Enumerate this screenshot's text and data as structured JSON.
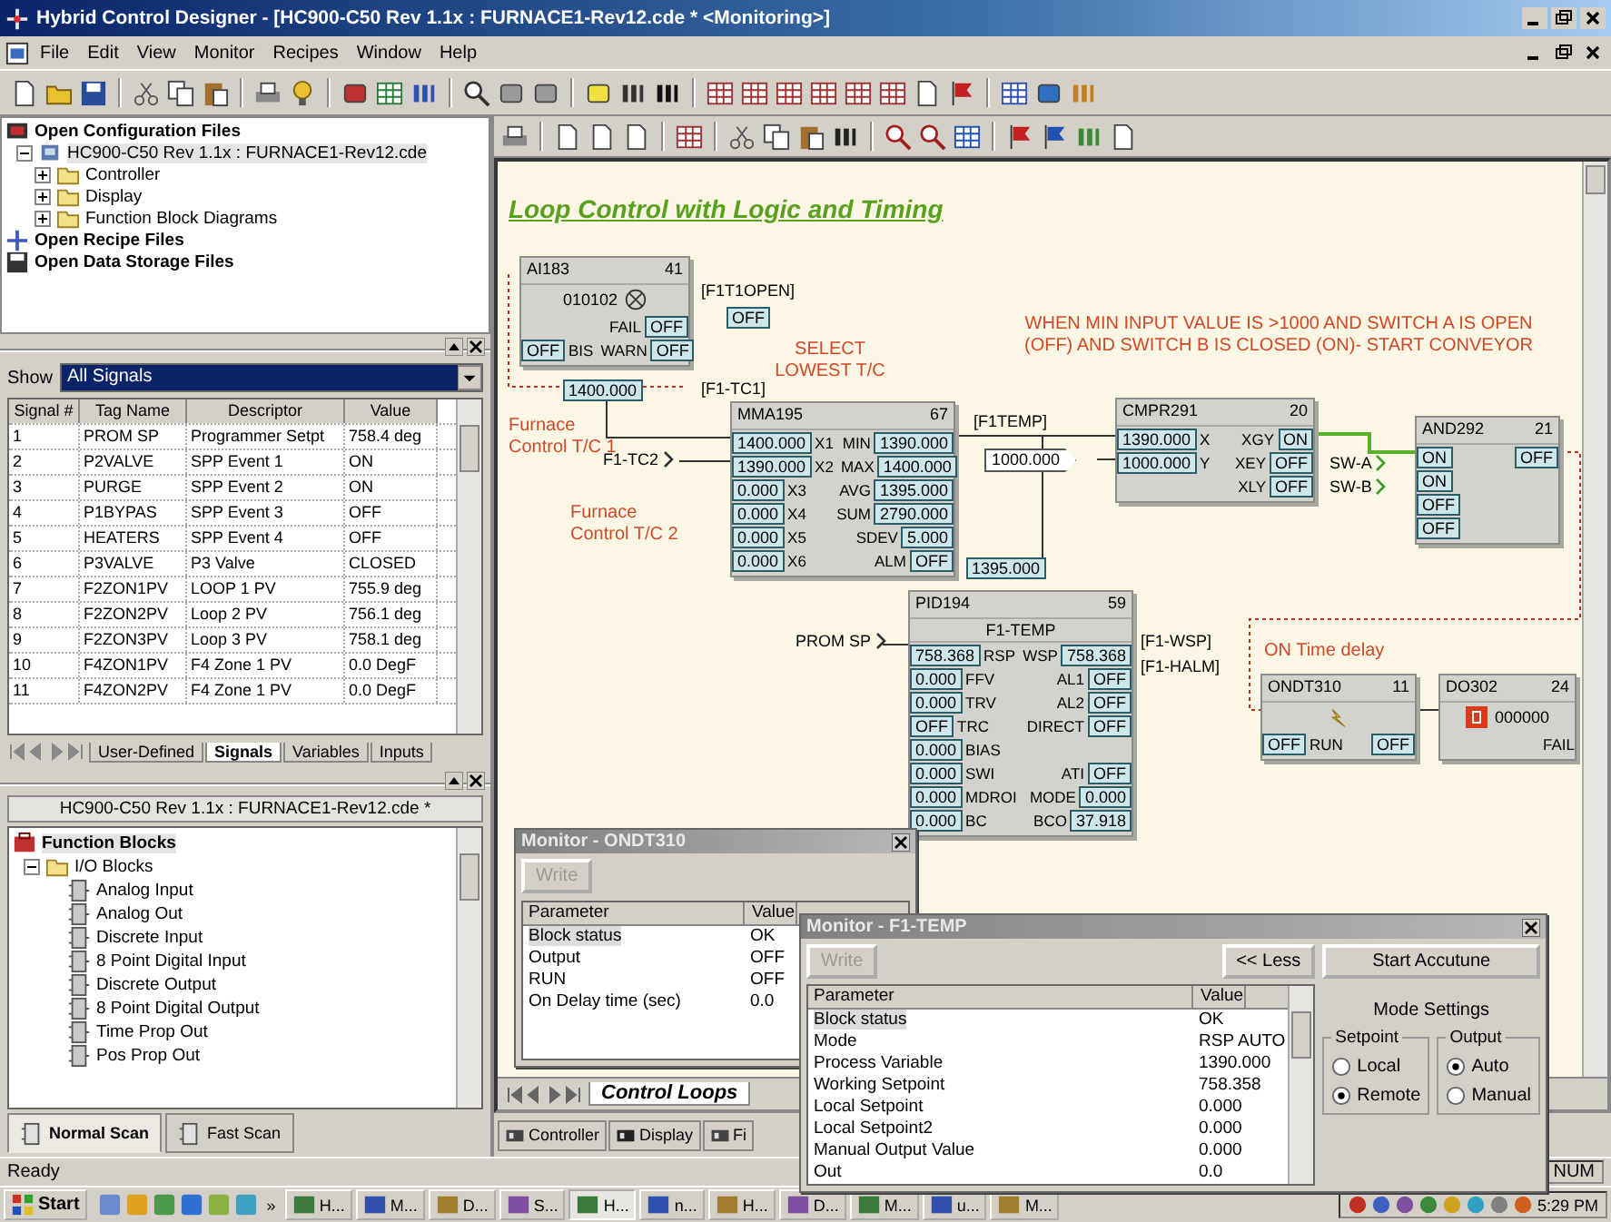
{
  "window": {
    "title": "Hybrid Control Designer  - [HC900-C50 Rev 1.1x : FURNACE1-Rev12.cde * <Monitoring>]"
  },
  "menu": [
    "File",
    "Edit",
    "View",
    "Monitor",
    "Recipes",
    "Window",
    "Help"
  ],
  "config_tree": [
    {
      "label": "Open Configuration Files",
      "selected": false,
      "children": [
        {
          "label": "HC900-C50 Rev 1.1x : FURNACE1-Rev12.cde",
          "selected": true,
          "expanded": true,
          "children": [
            {
              "label": "Controller",
              "selected": false,
              "expanded": false
            },
            {
              "label": "Display",
              "selected": false,
              "expanded": false
            },
            {
              "label": "Function Block Diagrams",
              "selected": false,
              "expanded": false
            }
          ]
        }
      ]
    },
    {
      "label": "Open Recipe Files",
      "selected": false
    },
    {
      "label": "Open Data Storage Files",
      "selected": false
    }
  ],
  "signals": {
    "show_label": "Show",
    "show_value": "All Signals",
    "columns": [
      "Signal #",
      "Tag Name",
      "Descriptor",
      "Value"
    ],
    "rows": [
      [
        "1",
        "PROM SP",
        "Programmer Setpt",
        "758.4 deg"
      ],
      [
        "2",
        "P2VALVE",
        "SPP Event 1",
        "ON"
      ],
      [
        "3",
        "PURGE",
        "SPP Event 2",
        "ON"
      ],
      [
        "4",
        "P1BYPAS",
        "SPP Event 3",
        "OFF"
      ],
      [
        "5",
        "HEATERS",
        "SPP Event 4",
        "OFF"
      ],
      [
        "6",
        "P3VALVE",
        "P3 Valve",
        "CLOSED"
      ],
      [
        "7",
        "F2ZON1PV",
        "LOOP 1 PV",
        "755.9 deg"
      ],
      [
        "8",
        "F2ZON2PV",
        "Loop 2 PV",
        "756.1 deg"
      ],
      [
        "9",
        "F2ZON3PV",
        "Loop 3 PV",
        "758.1 deg"
      ],
      [
        "10",
        "F4ZON1PV",
        "F4 Zone 1 PV",
        "0.0 DegF"
      ],
      [
        "11",
        "F4ZON2PV",
        "F4 Zone 1 PV",
        "0.0 DegF"
      ]
    ],
    "tabs": [
      {
        "label": "User-Defined",
        "selected": false
      },
      {
        "label": "Signals",
        "selected": true
      },
      {
        "label": "Variables",
        "selected": false
      },
      {
        "label": "Inputs",
        "selected": false
      }
    ]
  },
  "function_blocks": {
    "document": "HC900-C50 Rev 1.1x : FURNACE1-Rev12.cde *",
    "tree": {
      "label": "Function Blocks",
      "selected": true,
      "children": [
        {
          "label": "I/O Blocks",
          "selected": false,
          "expanded": true,
          "children": [
            {
              "label": "Analog Input",
              "selected": false
            },
            {
              "label": "Analog Out",
              "selected": false
            },
            {
              "label": "Discrete Input",
              "selected": false
            },
            {
              "label": "8 Point Digital Input",
              "selected": false
            },
            {
              "label": "Discrete Output",
              "selected": false
            },
            {
              "label": "8 Point Digital Output",
              "selected": false
            },
            {
              "label": "Time Prop Out",
              "selected": false
            },
            {
              "label": "Pos Prop Out",
              "selected": false
            }
          ]
        }
      ]
    },
    "tabs": [
      {
        "label": "Normal Scan",
        "selected": true
      },
      {
        "label": "Fast Scan",
        "selected": false
      }
    ]
  },
  "diagram": {
    "title": "Loop Control with Logic and Timing",
    "notes": [
      "SELECT\nLOWEST T/C",
      "Furnace\nControl T/C 1",
      "Furnace\nControl T/C 2",
      "WHEN MIN INPUT VALUE IS >1000 AND SWITCH A IS OPEN\n(OFF) AND SWITCH B IS CLOSED (ON)- START CONVEYOR",
      "ON Time delay"
    ],
    "tags": [
      "[F1T1OPEN]",
      "[F1-TC1]",
      "[F1TEMP]",
      "[F1-WSP]",
      "[F1-HALM]"
    ],
    "inputs": [
      "F1-TC2",
      "PROM SP",
      "SW-A",
      "SW-B"
    ],
    "constants": [
      "1000.000"
    ],
    "values": [
      "OFF",
      "1400.000",
      "1395.000"
    ],
    "blocks": [
      {
        "name": "AI183",
        "number": "41",
        "kind": "ai",
        "display": "010102",
        "rows": [
          {
            "out": "FAIL",
            "out_value": "OFF"
          },
          {
            "in": "BIS",
            "in_value": "OFF",
            "out": "WARN",
            "out_value": "OFF"
          }
        ]
      },
      {
        "name": "MMA195",
        "number": "67",
        "kind": "mma",
        "rows": [
          {
            "in": "X1",
            "in_value": "1400.000",
            "out": "MIN",
            "out_value": "1390.000"
          },
          {
            "in": "X2",
            "in_value": "1390.000",
            "out": "MAX",
            "out_value": "1400.000"
          },
          {
            "in": "X3",
            "in_value": "0.000",
            "out": "AVG",
            "out_value": "1395.000"
          },
          {
            "in": "X4",
            "in_value": "0.000",
            "out": "SUM",
            "out_value": "2790.000"
          },
          {
            "in": "X5",
            "in_value": "0.000",
            "out": "SDEV",
            "out_value": "5.000"
          },
          {
            "in": "X6",
            "in_value": "0.000",
            "out": "ALM",
            "out_value": "OFF"
          }
        ]
      },
      {
        "name": "PID194",
        "number": "59",
        "kind": "pid",
        "subtitle": "F1-TEMP",
        "rows": [
          {
            "in": "RSP",
            "in_value": "758.368",
            "out": "WSP",
            "out_value": "758.368"
          },
          {
            "in": "FFV",
            "in_value": "0.000",
            "out": "AL1",
            "out_value": "OFF"
          },
          {
            "in": "TRV",
            "in_value": "0.000",
            "out": "AL2",
            "out_value": "OFF"
          },
          {
            "in": "TRC",
            "in_value": "OFF",
            "out": "DIRECT",
            "out_value": "OFF"
          },
          {
            "in": "BIAS",
            "in_value": "0.000"
          },
          {
            "in": "SWI",
            "in_value": "0.000",
            "out": "ATI",
            "out_value": "OFF"
          },
          {
            "in": "MDROI",
            "in_value": "0.000",
            "out": "MODE",
            "out_value": "0.000"
          },
          {
            "in": "BC",
            "in_value": "0.000",
            "out": "BCO",
            "out_value": "37.918"
          }
        ]
      },
      {
        "name": "CMPR291",
        "number": "20",
        "kind": "cmpr",
        "rows": [
          {
            "in": "X",
            "in_value": "1390.000",
            "out": "XGY",
            "out_value": "ON"
          },
          {
            "in": "Y",
            "in_value": "1000.000",
            "out": "XEY",
            "out_value": "OFF"
          },
          {
            "out": "XLY",
            "out_value": "OFF"
          }
        ]
      },
      {
        "name": "AND292",
        "number": "21",
        "kind": "and",
        "rows": [
          {
            "in_value": "ON",
            "out_value": "OFF"
          },
          {
            "in_value": "ON"
          },
          {
            "in_value": "OFF"
          },
          {
            "in_value": "OFF"
          }
        ]
      },
      {
        "name": "ONDT310",
        "number": "11",
        "kind": "ondt",
        "rows": [
          {
            "in": "RUN",
            "in_value": "OFF",
            "out_value": "OFF"
          }
        ]
      },
      {
        "name": "DO302",
        "number": "24",
        "kind": "do",
        "display": "000000",
        "rows": [
          {
            "out": "FAIL"
          }
        ]
      }
    ],
    "tabs": [
      {
        "label": "Control Loops",
        "selected": true
      }
    ]
  },
  "workspace_tabs": [
    {
      "label": "Controller",
      "selected": false
    },
    {
      "label": "Display",
      "selected": false
    },
    {
      "label": "Fi",
      "selected": false
    }
  ],
  "monitor_ondt": {
    "title": "Monitor - ONDT310",
    "write": {
      "label": "Write",
      "disabled": true
    },
    "columns": [
      "Parameter",
      "Value"
    ],
    "rows": [
      {
        "param": "Block status",
        "value": "OK",
        "selected": true
      },
      {
        "param": "Output",
        "value": "OFF",
        "selected": false
      },
      {
        "param": "RUN",
        "value": "OFF",
        "selected": false
      },
      {
        "param": "On Delay time (sec)",
        "value": "0.0",
        "selected": false
      }
    ]
  },
  "monitor_pid": {
    "title": "Monitor - F1-TEMP",
    "write": {
      "label": "Write",
      "disabled": true
    },
    "less": "<< Less",
    "accutune": "Start Accutune",
    "columns": [
      "Parameter",
      "Value"
    ],
    "rows": [
      {
        "param": "Block status",
        "value": "OK",
        "selected": true
      },
      {
        "param": "Mode",
        "value": "RSP AUTO",
        "selected": false
      },
      {
        "param": "Process Variable",
        "value": "1390.000",
        "selected": false
      },
      {
        "param": "Working Setpoint",
        "value": "758.358",
        "selected": false
      },
      {
        "param": "Local Setpoint",
        "value": "0.000",
        "selected": false
      },
      {
        "param": "Local Setpoint2",
        "value": "0.000",
        "selected": false
      },
      {
        "param": "Manual Output Value",
        "value": "0.000",
        "selected": false
      },
      {
        "param": "Out",
        "value": "0.0",
        "selected": false
      }
    ],
    "mode_title": "Mode Settings",
    "groups": [
      {
        "title": "Setpoint",
        "options": [
          {
            "label": "Local",
            "selected": false
          },
          {
            "label": "Remote",
            "selected": true
          }
        ]
      },
      {
        "title": "Output",
        "options": [
          {
            "label": "Auto",
            "selected": true
          },
          {
            "label": "Manual",
            "selected": false
          }
        ]
      }
    ]
  },
  "status_bar": {
    "text": "Ready",
    "indicator": "NUM"
  },
  "taskbar": {
    "start": "Start",
    "more": "»",
    "tasks": [
      {
        "label": "H...",
        "selected": false
      },
      {
        "label": "M...",
        "selected": false
      },
      {
        "label": "D...",
        "selected": false
      },
      {
        "label": "S...",
        "selected": false
      },
      {
        "label": "H...",
        "selected": true
      },
      {
        "label": "n...",
        "selected": false
      },
      {
        "label": "H...",
        "selected": false
      },
      {
        "label": "D...",
        "selected": false
      },
      {
        "label": "M...",
        "selected": false
      },
      {
        "label": "u...",
        "selected": false
      },
      {
        "label": "M...",
        "selected": false
      }
    ],
    "clock": "5:29 PM"
  }
}
